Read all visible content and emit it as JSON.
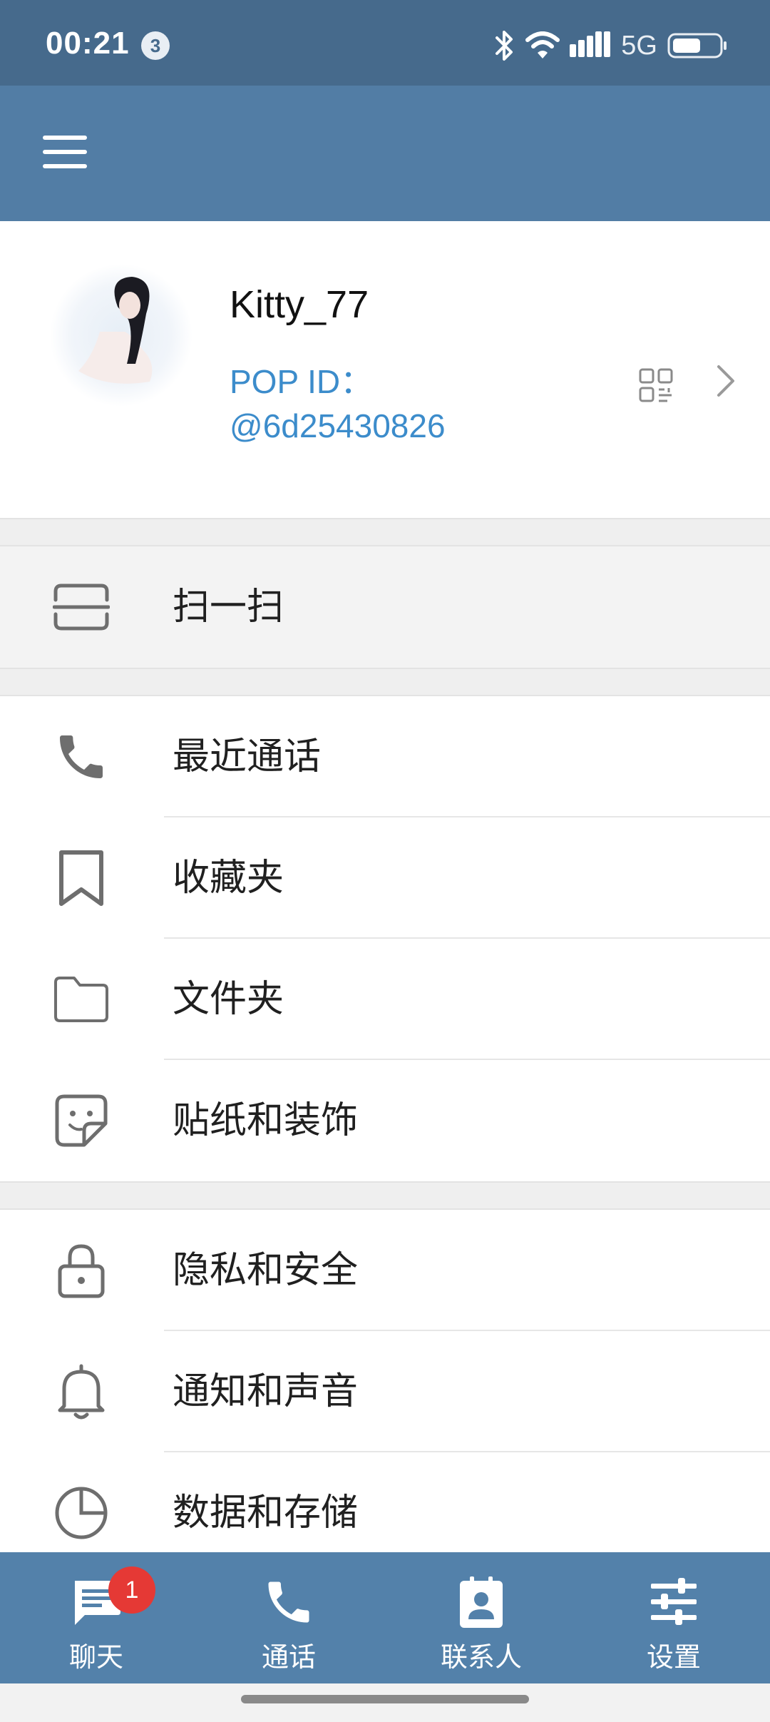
{
  "status_bar": {
    "time": "00:21",
    "notification_count": "3",
    "network": "5G",
    "icons": [
      "bluetooth-icon",
      "wifi-icon",
      "signal-icon",
      "battery-icon"
    ]
  },
  "app_bar": {
    "menu_icon": "hamburger-menu-icon"
  },
  "profile": {
    "name": "Kitty_77",
    "id_label": "POP ID：",
    "id_value": "@6d25430826",
    "qr_icon": "qr-code-icon",
    "chevron_icon": "chevron-right-icon"
  },
  "menu": {
    "scan": {
      "label": "扫一扫",
      "icon": "scan-icon"
    },
    "recent_calls": {
      "label": "最近通话",
      "icon": "phone-icon"
    },
    "favorites": {
      "label": "收藏夹",
      "icon": "bookmark-icon"
    },
    "folders": {
      "label": "文件夹",
      "icon": "folder-icon"
    },
    "stickers": {
      "label": "贴纸和装饰",
      "icon": "sticker-icon"
    },
    "privacy": {
      "label": "隐私和安全",
      "icon": "lock-icon"
    },
    "notifications": {
      "label": "通知和声音",
      "icon": "bell-icon"
    },
    "data_storage": {
      "label": "数据和存储",
      "icon": "pie-chart-icon"
    }
  },
  "bottom_nav": {
    "chats": {
      "label": "聊天",
      "badge": "1",
      "icon": "chat-icon"
    },
    "calls": {
      "label": "通话",
      "icon": "phone-icon"
    },
    "contacts": {
      "label": "联系人",
      "icon": "contacts-icon"
    },
    "settings": {
      "label": "设置",
      "icon": "settings-sliders-icon",
      "active": true
    }
  },
  "colors": {
    "status_bar": "#466a8c",
    "app_bar": "#527da5",
    "bottom_nav": "#5381aa",
    "accent": "#3c8ccb",
    "badge": "#e53935"
  }
}
